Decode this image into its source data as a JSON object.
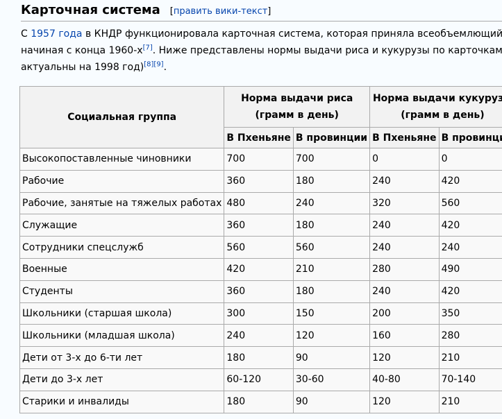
{
  "heading": {
    "title": "Карточная система",
    "edit_open": "[",
    "edit_link": "править вики-текст",
    "edit_close": "]"
  },
  "intro": {
    "line1_a": "С ",
    "line1_link": "1957 года",
    "line1_b": " в КНДР функционировала карточная система, которая приняла всеобъемлющий характе",
    "line2_a": "начиная с конца 1960-х",
    "ref7": "[7]",
    "line2_b": ". Ниже представлены нормы выдачи риса и кукурузы по карточкам (данные",
    "line3_a": "актуальны на 1998 год)",
    "ref8": "[8]",
    "ref9": "[9]",
    "line3_b": "."
  },
  "table": {
    "head": {
      "group_col": "Социальная группа",
      "rice_line1": "Норма выдачи риса",
      "rice_line2": "(грамм в день)",
      "corn_line1": "Норма выдачи кукурузы",
      "corn_line2": "(грамм в день)",
      "sub": [
        "В Пхеньяне",
        "В провинции",
        "В Пхеньяне",
        "В провинции"
      ]
    },
    "rows": [
      [
        "Высокопоставленные чиновники",
        "700",
        "700",
        "0",
        "0"
      ],
      [
        "Рабочие",
        "360",
        "180",
        "240",
        "420"
      ],
      [
        "Рабочие, занятые на тяжелых работах",
        "480",
        "240",
        "320",
        "560"
      ],
      [
        "Служащие",
        "360",
        "180",
        "240",
        "420"
      ],
      [
        "Сотрудники спецслужб",
        "560",
        "560",
        "240",
        "240"
      ],
      [
        "Военные",
        "420",
        "210",
        "280",
        "490"
      ],
      [
        "Студенты",
        "360",
        "180",
        "240",
        "420"
      ],
      [
        "Школьники (старшая школа)",
        "300",
        "150",
        "200",
        "350"
      ],
      [
        "Школьники (младшая школа)",
        "240",
        "120",
        "160",
        "280"
      ],
      [
        "Дети от 3-х до 6-ти лет",
        "180",
        "90",
        "120",
        "210"
      ],
      [
        "Дети до 3-х лет",
        "60-120",
        "30-60",
        "40-80",
        "70-140"
      ],
      [
        "Старики и инвалиды",
        "180",
        "90",
        "120",
        "210"
      ]
    ]
  },
  "colors": {
    "link": "#0645ad",
    "border": "#aaaaaa",
    "header_bg": "#f2f2f2",
    "cell_bg": "#f9f9f9",
    "page_bg": "#f8fcff"
  }
}
